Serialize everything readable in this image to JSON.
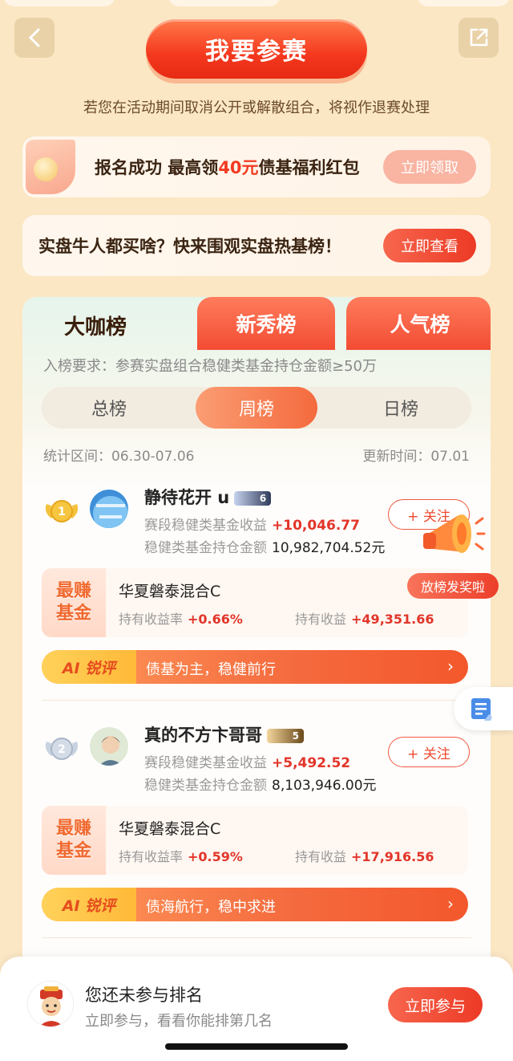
{
  "header": {
    "join_label": "我要参赛",
    "notice": "若您在活动期间取消公开或解散组合，将视作退赛处理"
  },
  "banners": {
    "redpacket": {
      "text_pre": "报名成功 最高领",
      "text_highlight": "40元",
      "text_post": "债基福利红包",
      "button": "立即领取"
    },
    "hotfunds": {
      "text": "实盘牛人都买啥？快来围观实盘热基榜！",
      "button": "立即查看"
    }
  },
  "tabs": [
    {
      "label": "大咖榜",
      "active": true
    },
    {
      "label": "新秀榜",
      "active": false
    },
    {
      "label": "人气榜",
      "active": false
    }
  ],
  "requirement": "入榜要求：参赛实盘组合稳健类基金持仓金额≥50万",
  "segments": [
    {
      "label": "总榜",
      "active": false
    },
    {
      "label": "周榜",
      "active": true
    },
    {
      "label": "日榜",
      "active": false
    }
  ],
  "period_text": "统计区间：06.30-07.06",
  "updated_text": "更新时间：07.01",
  "entries": [
    {
      "rank": "1",
      "name": "静待花开 u",
      "level": "6",
      "income_label": "赛段稳健类基金收益",
      "income_value": "+10,046.77",
      "holding_label": "稳健类基金持仓金额",
      "holding_value": "10,982,704.52元",
      "follow_label": "+ 关注",
      "fund_tag": [
        "最赚",
        "基金"
      ],
      "fund_name": "华夏磐泰混合C",
      "rate_label": "持有收益率",
      "rate_value": "+0.66%",
      "gain_label": "持有收益",
      "gain_value": "+49,351.66",
      "ai_label": "AI 锐评",
      "ai_text": "债基为主，稳健前行"
    },
    {
      "rank": "2",
      "name": "真的不方卞哥哥",
      "level": "5",
      "income_label": "赛段稳健类基金收益",
      "income_value": "+5,492.52",
      "holding_label": "稳健类基金持仓金额",
      "holding_value": "8,103,946.00元",
      "follow_label": "+ 关注",
      "fund_tag": [
        "最赚",
        "基金"
      ],
      "fund_name": "华夏磐泰混合C",
      "rate_label": "持有收益率",
      "rate_value": "+0.59%",
      "gain_label": "持有收益",
      "gain_value": "+17,916.56",
      "ai_label": "AI 锐评",
      "ai_text": "债海航行，稳中求进"
    }
  ],
  "prize_label": "放榜发奖啦",
  "footer": {
    "title": "您还未参与排名",
    "subtitle": "立即参与，看看你能排第几名",
    "button": "立即参与"
  }
}
